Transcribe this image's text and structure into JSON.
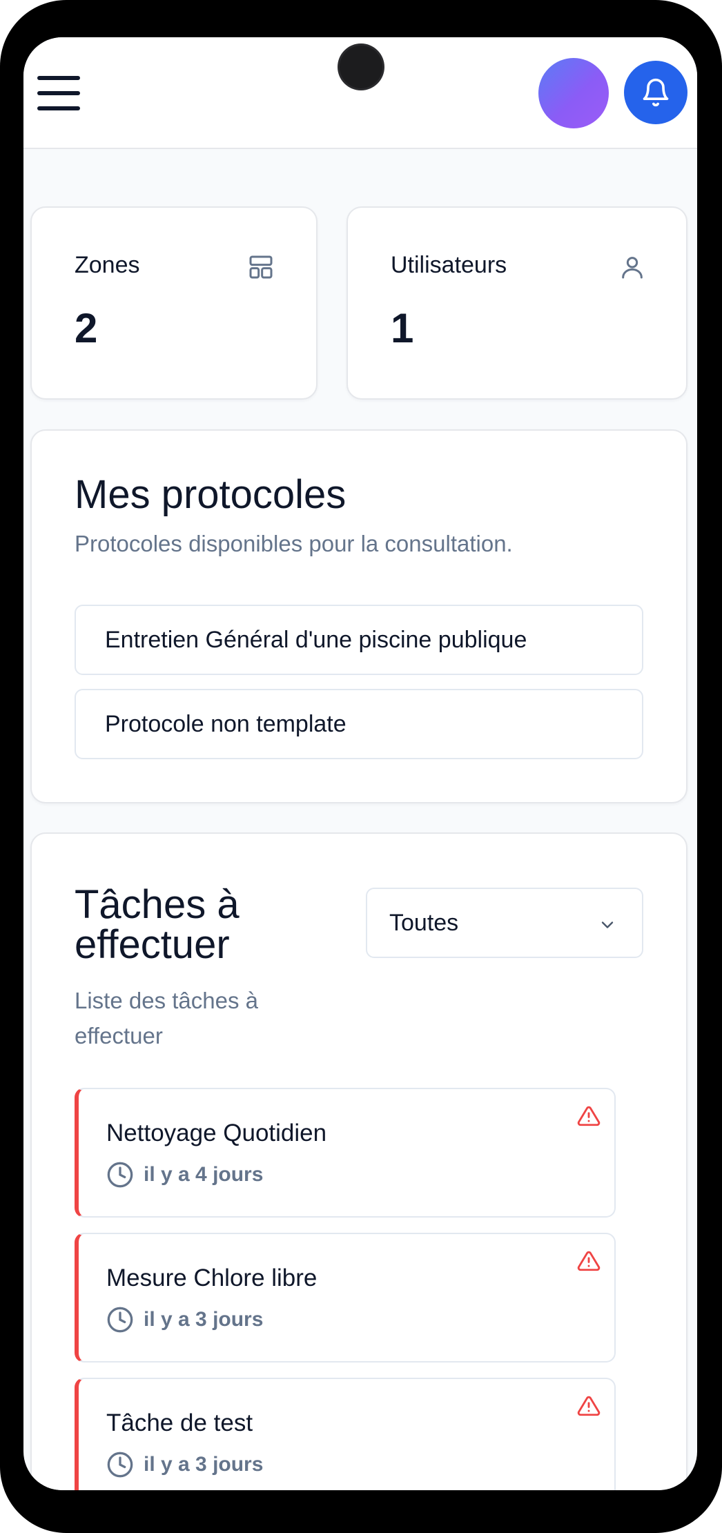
{
  "header": {
    "menu_icon": "hamburger-menu-icon",
    "avatar_icon": "user-avatar",
    "bell_icon": "bell-icon",
    "bell_color": "#2563eb"
  },
  "stats": [
    {
      "label": "Zones",
      "value": "2",
      "icon": "layout-grid-icon"
    },
    {
      "label": "Utilisateurs",
      "value": "1",
      "icon": "user-icon"
    }
  ],
  "protocols": {
    "title": "Mes protocoles",
    "subtitle": "Protocoles disponibles pour la consultation.",
    "items": [
      "Entretien Général d'une piscine publique",
      "Protocole non template"
    ]
  },
  "tasks": {
    "title_line1": "Tâches à",
    "title_line2": "effectuer",
    "subtitle_line1": "Liste des tâches à",
    "subtitle_line2": "effectuer",
    "filter": {
      "selected": "Toutes",
      "icon": "chevron-down-icon"
    },
    "accent_color": "#ef4444",
    "items": [
      {
        "name": "Nettoyage Quotidien",
        "time": "il y a 4 jours",
        "status_icon": "alert-triangle-icon",
        "time_icon": "clock-icon"
      },
      {
        "name": "Mesure Chlore libre",
        "time": "il y a 3 jours",
        "status_icon": "alert-triangle-icon",
        "time_icon": "clock-icon"
      },
      {
        "name": "Tâche de test",
        "time": "il y a 3 jours",
        "status_icon": "alert-triangle-icon",
        "time_icon": "clock-icon"
      }
    ]
  }
}
